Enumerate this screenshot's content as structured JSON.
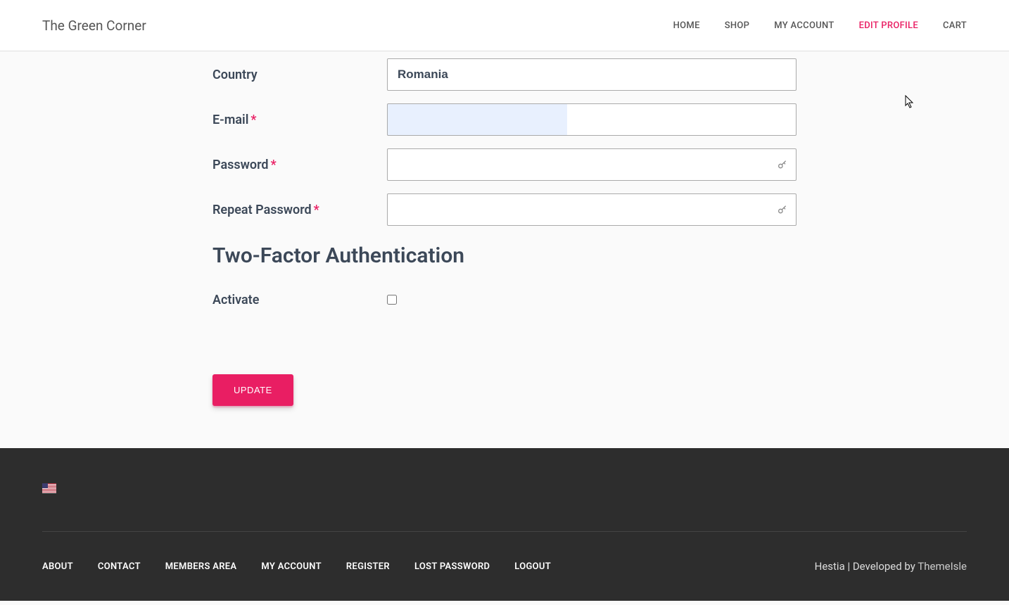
{
  "header": {
    "site_title": "The Green Corner",
    "nav": [
      {
        "label": "HOME",
        "active": false
      },
      {
        "label": "SHOP",
        "active": false
      },
      {
        "label": "MY ACCOUNT",
        "active": false
      },
      {
        "label": "EDIT PROFILE",
        "active": true
      },
      {
        "label": "CART",
        "active": false
      }
    ]
  },
  "form": {
    "country": {
      "label": "Country",
      "value": "Romania",
      "required": false
    },
    "email": {
      "label": "E-mail",
      "value": "",
      "required": true
    },
    "password": {
      "label": "Password",
      "value": "",
      "required": true
    },
    "repeat_password": {
      "label": "Repeat Password",
      "value": "",
      "required": true
    },
    "two_factor_heading": "Two-Factor Authentication",
    "activate": {
      "label": "Activate",
      "checked": false
    },
    "submit_label": "UPDATE"
  },
  "footer": {
    "links": [
      "ABOUT",
      "CONTACT",
      "MEMBERS AREA",
      "MY ACCOUNT",
      "REGISTER",
      "LOST PASSWORD",
      "LOGOUT"
    ],
    "credit_prefix": "Hestia | Developed by ",
    "credit_link": "ThemeIsle"
  }
}
